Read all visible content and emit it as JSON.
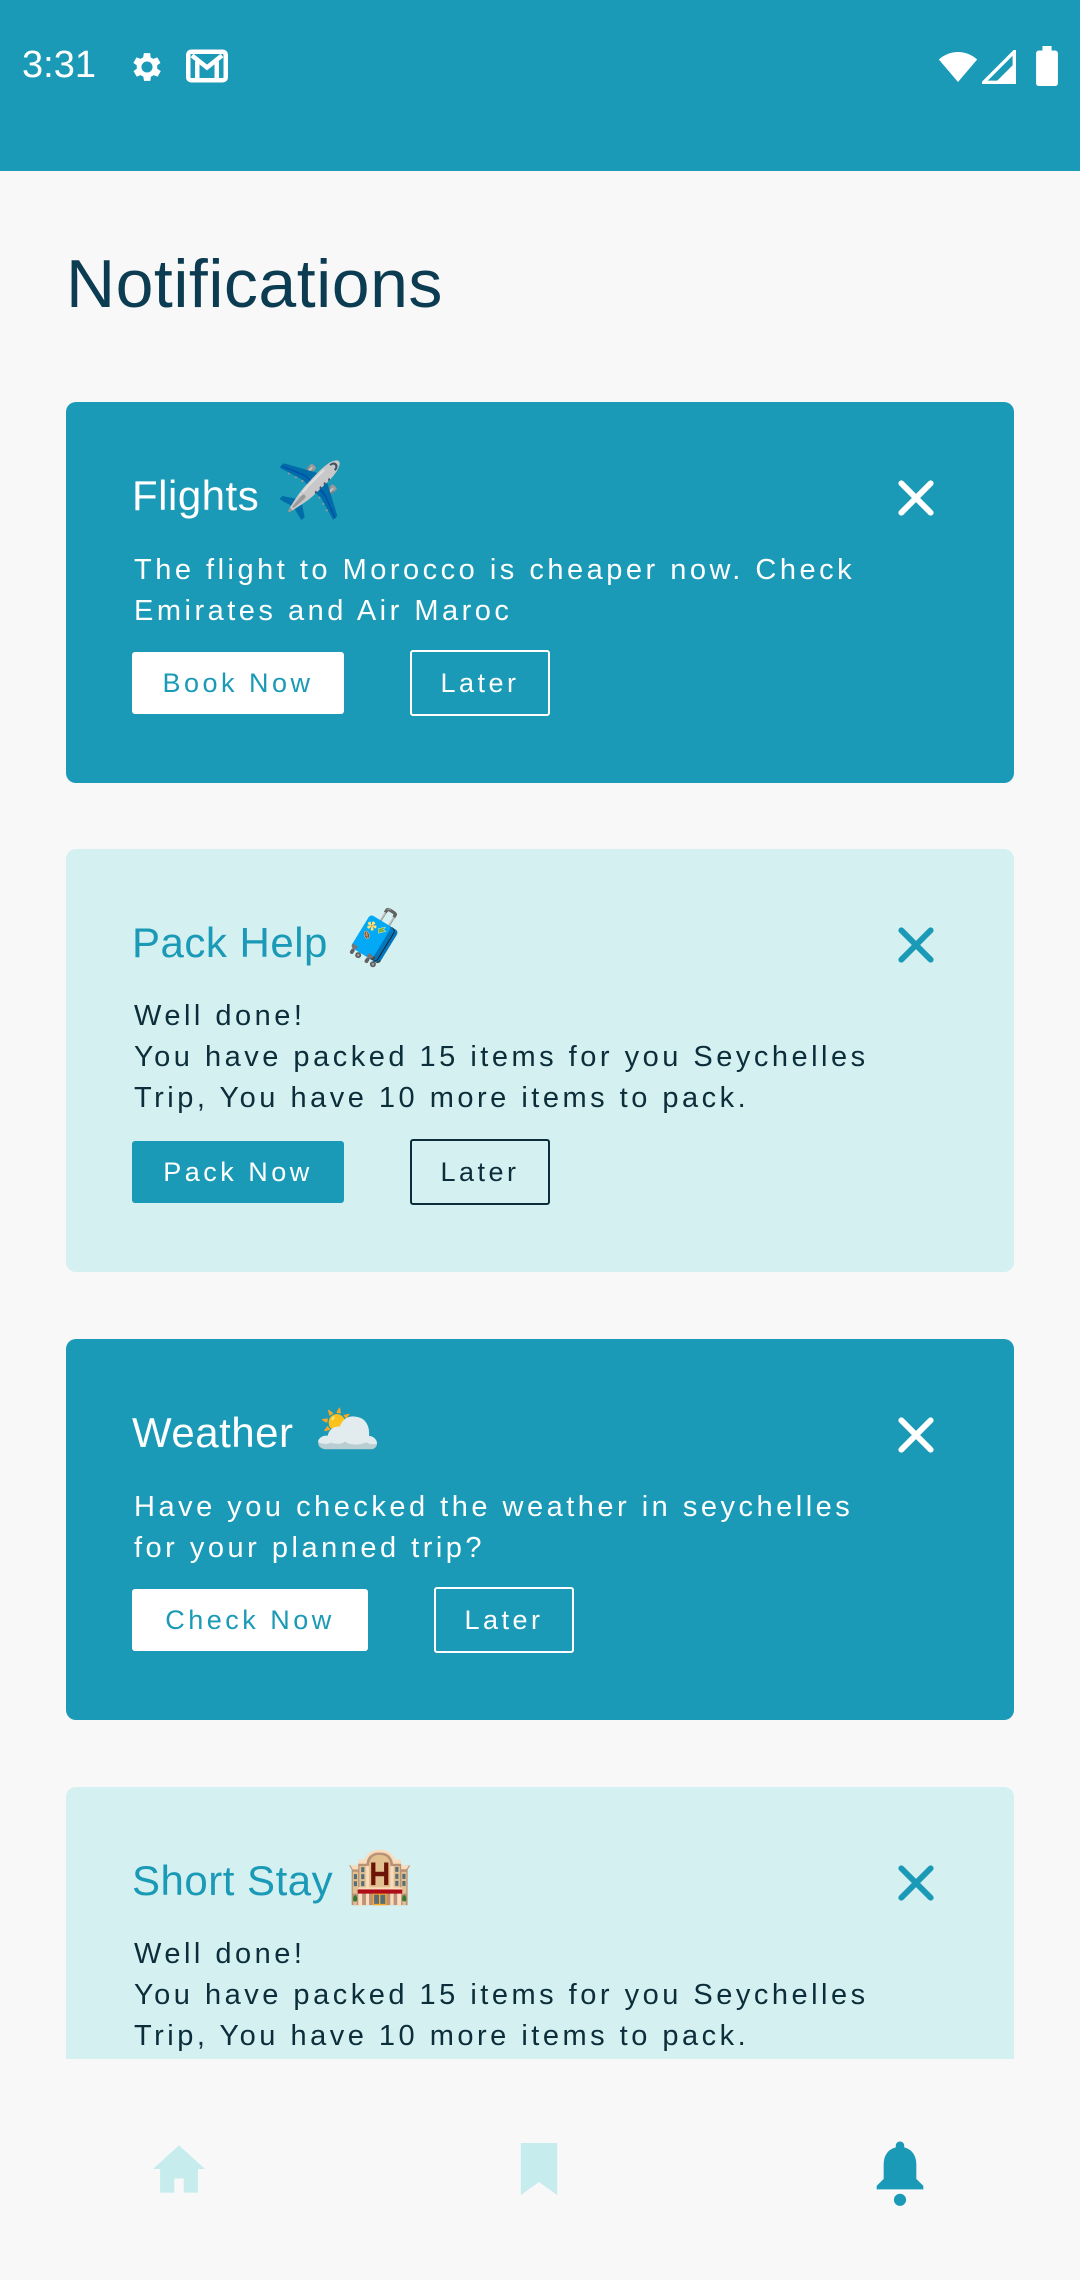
{
  "status_bar": {
    "time": "3:31",
    "left_icons": [
      "gear-icon",
      "gmail-icon"
    ],
    "right_icons": [
      "wifi-icon",
      "signal-icon",
      "battery-icon"
    ],
    "color": "#1A9AB6"
  },
  "page": {
    "title": "Notifications"
  },
  "cards": [
    {
      "title": "Flights",
      "emoji": "✈️",
      "body": "The flight to Morocco is cheaper now. Check\nEmirates and Air Maroc",
      "primary_label": "Book Now",
      "secondary_label": "Later",
      "style": "dark"
    },
    {
      "title": "Pack Help",
      "emoji": "🧳",
      "body": "Well done!\nYou have packed 15 items for you Seychelles\nTrip, You have 10 more items to pack.",
      "primary_label": "Pack Now",
      "secondary_label": "Later",
      "style": "light"
    },
    {
      "title": "Weather",
      "emoji": "🌥️",
      "body": "Have you checked the weather in seychelles\nfor your planned trip?",
      "primary_label": "Check Now",
      "secondary_label": "Later",
      "style": "dark"
    },
    {
      "title": "Short Stay",
      "emoji": "🏨",
      "body": "Well done!\nYou have packed 15 items for you Seychelles\nTrip, You have 10 more items to pack.",
      "style": "light"
    }
  ],
  "bottom_nav": {
    "items": [
      {
        "icon": "home-icon",
        "active": false
      },
      {
        "icon": "bookmark-icon",
        "active": false
      },
      {
        "icon": "bell-icon",
        "active": true
      }
    ],
    "active_color": "#1A9AB6",
    "inactive_color": "#C6ECEE"
  },
  "colors": {
    "primary": "#1A9AB6",
    "light_card": "#D4F0F1",
    "title_text": "#0C3C52",
    "background": "#F8F8F8"
  }
}
